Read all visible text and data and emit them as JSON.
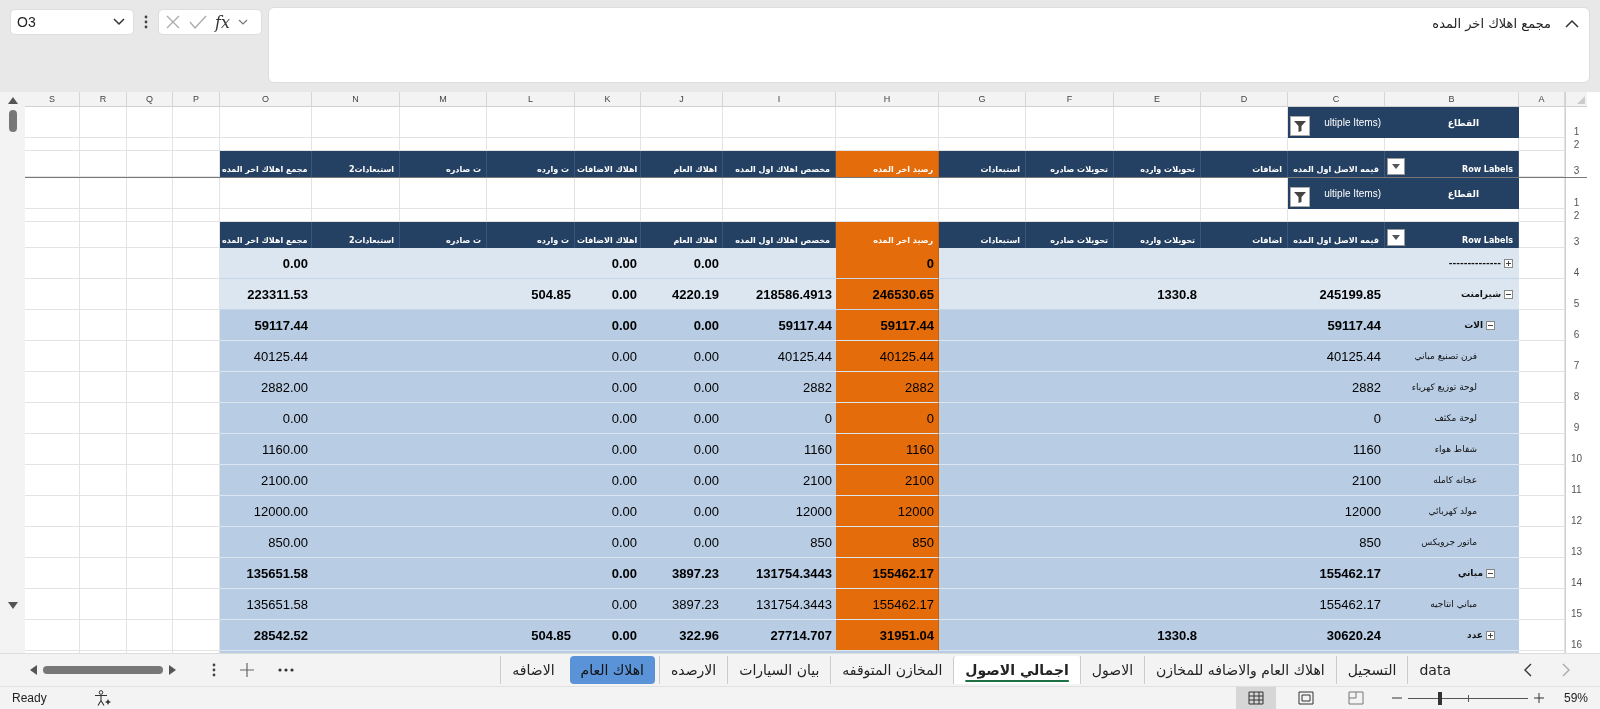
{
  "formula_bar": {
    "name_box": "O3",
    "function_label": "fx",
    "formula": "مجمع اهلاك اخر المده"
  },
  "columns": [
    "A",
    "B",
    "C",
    "D",
    "E",
    "F",
    "G",
    "H",
    "I",
    "J",
    "K",
    "L",
    "M",
    "N",
    "O",
    "P",
    "Q",
    "R",
    "S"
  ],
  "frozen_header": {
    "filter_row": "1",
    "filter_label": "القطاع",
    "filter_value": "ultiple Items)",
    "spacer_row": "2",
    "fields_row": "3",
    "fields": [
      {
        "label": "Row Labels",
        "highlight": false,
        "dropdown": true
      },
      {
        "label": "قيمه الاصل اول المده",
        "highlight": false
      },
      {
        "label": "اضافات",
        "highlight": false
      },
      {
        "label": "تحويلات وارده",
        "highlight": false
      },
      {
        "label": "تحويلات صادره",
        "highlight": false
      },
      {
        "label": "استبعادات",
        "highlight": false
      },
      {
        "label": "رصيد اخر المده",
        "highlight": true
      },
      {
        "label": "مخصص اهلاك اول المده",
        "highlight": false
      },
      {
        "label": "اهلاك العام",
        "highlight": false
      },
      {
        "label": "اهلاك الاضافات",
        "highlight": false
      },
      {
        "label": "ت وارده",
        "highlight": false
      },
      {
        "label": "ت صادره",
        "highlight": false
      },
      {
        "label": "استبعادات2",
        "highlight": false
      },
      {
        "label": "مجمع اهلاك اخر المده",
        "highlight": false
      }
    ]
  },
  "pivot_header": {
    "filter_row": "1",
    "filter_label": "القطاع",
    "filter_value": "ultiple Items)",
    "spacer_row": "2",
    "fields_row": "3",
    "fields": [
      {
        "label": "Row Labels",
        "highlight": false,
        "dropdown": true
      },
      {
        "label": "قيمه الاصل اول المده",
        "highlight": false
      },
      {
        "label": "اضافات",
        "highlight": false
      },
      {
        "label": "تحويلات وارده",
        "highlight": false
      },
      {
        "label": "تحويلات صادره",
        "highlight": false
      },
      {
        "label": "استبعادات",
        "highlight": false
      },
      {
        "label": "رصيد اخر المده",
        "highlight": true
      },
      {
        "label": "مخصص اهلاك اول المده",
        "highlight": false
      },
      {
        "label": "اهلاك العام",
        "highlight": false
      },
      {
        "label": "اهلاك الاضافات",
        "highlight": false
      },
      {
        "label": "ت وارده",
        "highlight": false
      },
      {
        "label": "ت صادره",
        "highlight": false
      },
      {
        "label": "استبعادات2",
        "highlight": false
      },
      {
        "label": "مجمع اهلاك اخر المده",
        "highlight": false
      }
    ]
  },
  "rows": [
    {
      "row": "4",
      "label": "--------------",
      "expanded": false,
      "values": {
        "O": "0.00",
        "K": "0.00",
        "J": "0.00",
        "H": "0"
      }
    },
    {
      "row": "5",
      "label": "شيرامنت",
      "expanded": true,
      "values": {
        "O": "223311.53",
        "L": "504.85",
        "K": "0.00",
        "J": "4220.19",
        "I": "218586.4913",
        "H": "246530.65",
        "E": "1330.8",
        "C": "245199.85"
      },
      "children": [
        {
          "row": "6",
          "label": "الات",
          "expanded": true,
          "values": {
            "O": "59117.44",
            "K": "0.00",
            "J": "0.00",
            "I": "59117.44",
            "H": "59117.44",
            "C": "59117.44"
          },
          "children": [
            {
              "row": "7",
              "label": "فرن تصنيع مباني",
              "values": {
                "O": "40125.44",
                "K": "0.00",
                "J": "0.00",
                "I": "40125.44",
                "H": "40125.44",
                "C": "40125.44"
              }
            },
            {
              "row": "8",
              "label": "لوحة توزيع كهرباء",
              "values": {
                "O": "2882.00",
                "K": "0.00",
                "J": "0.00",
                "I": "2882",
                "H": "2882",
                "C": "2882"
              }
            },
            {
              "row": "9",
              "label": "لوحة مكثف",
              "values": {
                "O": "0.00",
                "K": "0.00",
                "J": "0.00",
                "I": "0",
                "H": "0",
                "C": "0"
              }
            },
            {
              "row": "10",
              "label": "شفاط هواء",
              "values": {
                "O": "1160.00",
                "K": "0.00",
                "J": "0.00",
                "I": "1160",
                "H": "1160",
                "C": "1160"
              }
            },
            {
              "row": "11",
              "label": "عجانه كامله",
              "values": {
                "O": "2100.00",
                "K": "0.00",
                "J": "0.00",
                "I": "2100",
                "H": "2100",
                "C": "2100"
              }
            },
            {
              "row": "12",
              "label": "مولد كهربائي",
              "values": {
                "O": "12000.00",
                "K": "0.00",
                "J": "0.00",
                "I": "12000",
                "H": "12000",
                "C": "12000"
              }
            },
            {
              "row": "13",
              "label": "ماتور جرويكس",
              "values": {
                "O": "850.00",
                "K": "0.00",
                "J": "0.00",
                "I": "850",
                "H": "850",
                "C": "850"
              }
            }
          ]
        },
        {
          "row": "14",
          "label": "مباني",
          "expanded": true,
          "values": {
            "O": "135651.58",
            "K": "0.00",
            "J": "3897.23",
            "I": "131754.3443",
            "H": "155462.17",
            "C": "155462.17"
          },
          "children": [
            {
              "row": "15",
              "label": "مباني انتاجيه",
              "values": {
                "O": "135651.58",
                "K": "0.00",
                "J": "3897.23",
                "I": "131754.3443",
                "H": "155462.17",
                "C": "155462.17"
              }
            }
          ]
        },
        {
          "row": "16",
          "label": "عدد",
          "expanded": false,
          "values": {
            "O": "28542.52",
            "L": "504.85",
            "K": "0.00",
            "J": "322.96",
            "I": "27714.707",
            "H": "31951.04",
            "E": "1330.8",
            "C": "30620.24"
          }
        }
      ]
    }
  ],
  "sheet_tabs": [
    {
      "label": "data",
      "selected": false
    },
    {
      "label": "التسجيل",
      "selected": false
    },
    {
      "label": "اهلاك العام والاضافه للمخازن",
      "selected": false
    },
    {
      "label": "الاصول",
      "selected": false
    },
    {
      "label": "اجمالي الاصول",
      "selected": true
    },
    {
      "label": "المخازن المتوقفه",
      "selected": false
    },
    {
      "label": "بيان السيارات",
      "selected": false
    },
    {
      "label": "الارصده",
      "selected": false
    },
    {
      "label": "اهلاك العام",
      "selected": false,
      "color": "#5b93d9"
    },
    {
      "label": "الاضافه",
      "selected": false
    }
  ],
  "status_bar": {
    "status": "Ready",
    "views": [
      {
        "kind": "normal",
        "selected": true
      },
      {
        "kind": "layout",
        "selected": false
      },
      {
        "kind": "break",
        "selected": false
      }
    ],
    "zoom": {
      "level": 0.27,
      "reading": "59%"
    }
  }
}
